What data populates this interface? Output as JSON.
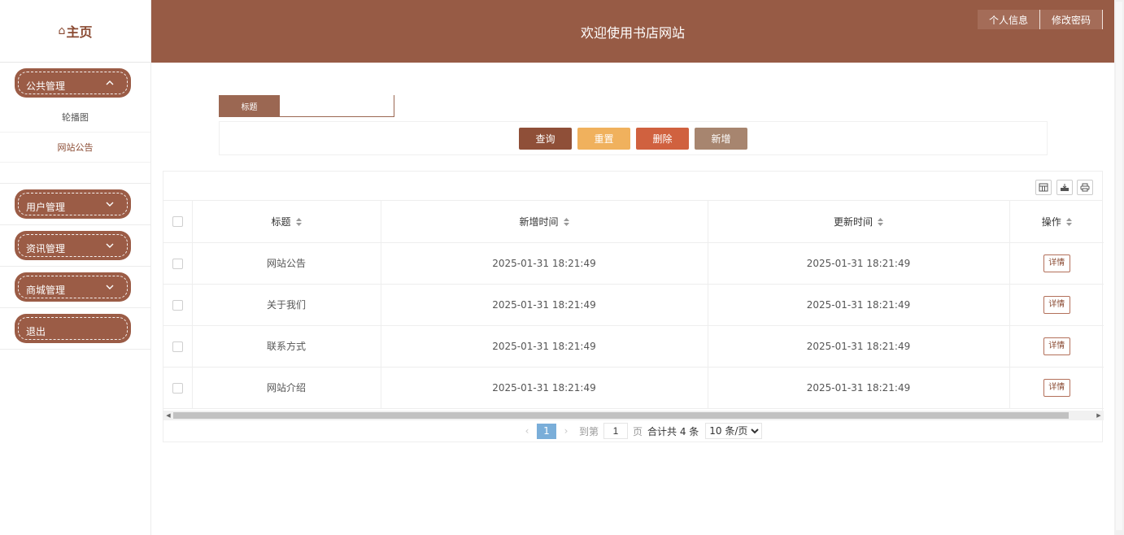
{
  "brand": {
    "home_icon": "⌂",
    "title": "主页"
  },
  "header": {
    "title": "欢迎使用书店网站",
    "buttons": [
      "个人信息",
      "修改密码"
    ]
  },
  "sidebar": {
    "groups": [
      {
        "label": "公共管理",
        "expanded": true,
        "items": [
          "轮播图",
          "网站公告"
        ],
        "active_item": "网站公告"
      },
      {
        "label": "用户管理",
        "expanded": false
      },
      {
        "label": "资讯管理",
        "expanded": false
      },
      {
        "label": "商城管理",
        "expanded": false
      },
      {
        "label": "退出",
        "expanded": false
      }
    ]
  },
  "search": {
    "label": "标题",
    "value": ""
  },
  "actions": {
    "query": "查询",
    "reset": "重置",
    "delete": "删除",
    "add": "新增"
  },
  "colors": {
    "query": "#8f4f38",
    "reset": "#f0b15d",
    "delete": "#d0613f",
    "add": "#a7856f"
  },
  "toolbar_icons": [
    "columns-icon",
    "export-icon",
    "print-icon"
  ],
  "table": {
    "columns": [
      "标题",
      "新增时间",
      "更新时间",
      "操作"
    ],
    "rows": [
      {
        "title": "网站公告",
        "created": "2025-01-31 18:21:49",
        "updated": "2025-01-31 18:21:49",
        "action": "详情"
      },
      {
        "title": "关于我们",
        "created": "2025-01-31 18:21:49",
        "updated": "2025-01-31 18:21:49",
        "action": "详情"
      },
      {
        "title": "联系方式",
        "created": "2025-01-31 18:21:49",
        "updated": "2025-01-31 18:21:49",
        "action": "详情"
      },
      {
        "title": "网站介绍",
        "created": "2025-01-31 18:21:49",
        "updated": "2025-01-31 18:21:49",
        "action": "详情"
      }
    ]
  },
  "pagination": {
    "prev": "‹",
    "current": "1",
    "next": "›",
    "goto_label": "到第",
    "goto_value": "1",
    "page_unit": "页",
    "total": "合计共 4 条",
    "page_size": "10 条/页"
  }
}
